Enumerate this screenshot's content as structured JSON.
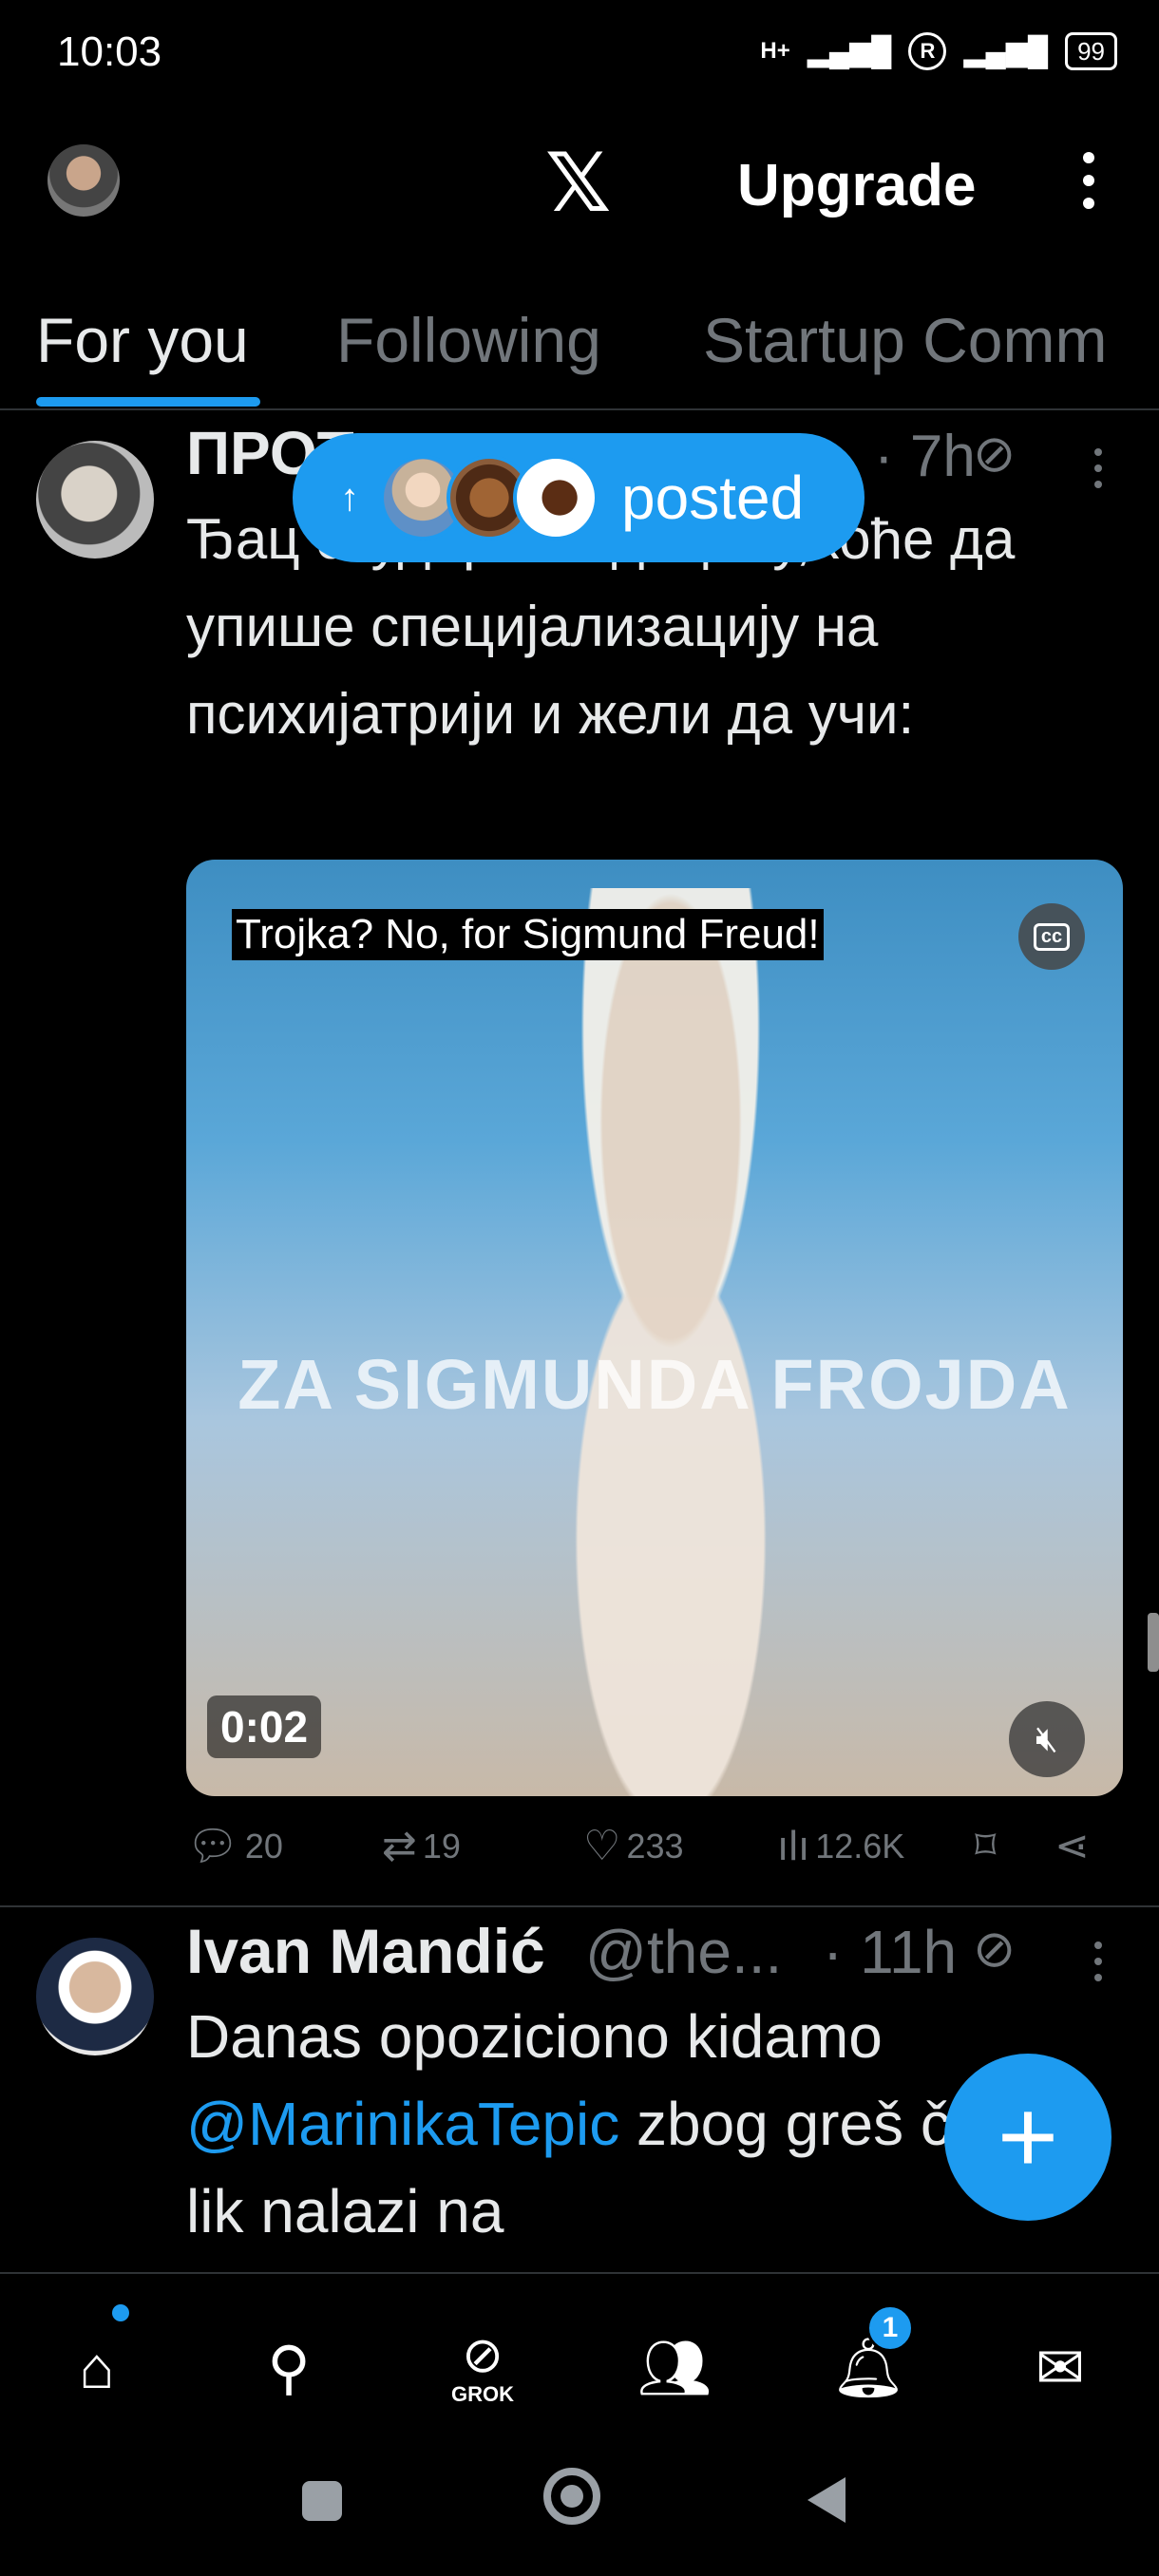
{
  "status_bar": {
    "time": "10:03",
    "network_1": "H+",
    "r_icon": "R",
    "battery": "99"
  },
  "header": {
    "logo": "𝕏",
    "upgrade_label": "Upgrade"
  },
  "tabs": [
    {
      "label": "For you",
      "active": true
    },
    {
      "label": "Following",
      "active": false
    },
    {
      "label": "Startup Comm",
      "active": false
    }
  ],
  "new_posts_pill": {
    "arrow": "↑",
    "label": "posted"
  },
  "tweet1": {
    "name": "ПРОТ",
    "time": "· 7h",
    "text": "Ђац студира медицину,хоће да упише специјализацију на психијатрији и жели да учи:",
    "media": {
      "caption": "Trojka? No, for Sigmund Freud!",
      "overlay_text": "ZA SIGMUNDA FROJDA",
      "cc": "cc",
      "duration": "0:02"
    },
    "actions": {
      "replies": "20",
      "reposts": "19",
      "likes": "233",
      "views": "12.6K"
    }
  },
  "tweet2": {
    "name": "Ivan Mandić",
    "handle": "@the...",
    "time": "· 11h",
    "text_before": "Danas opoziciono kidamo ",
    "mention": "@MarinikaTepic",
    "text_after": " zbog greš čiji se lik nalazi na"
  },
  "bottom_nav": {
    "grok_label": "GROK",
    "notifications_badge": "1"
  },
  "colors": {
    "accent": "#1d9bf0",
    "background": "#000000",
    "muted": "#71767b"
  }
}
